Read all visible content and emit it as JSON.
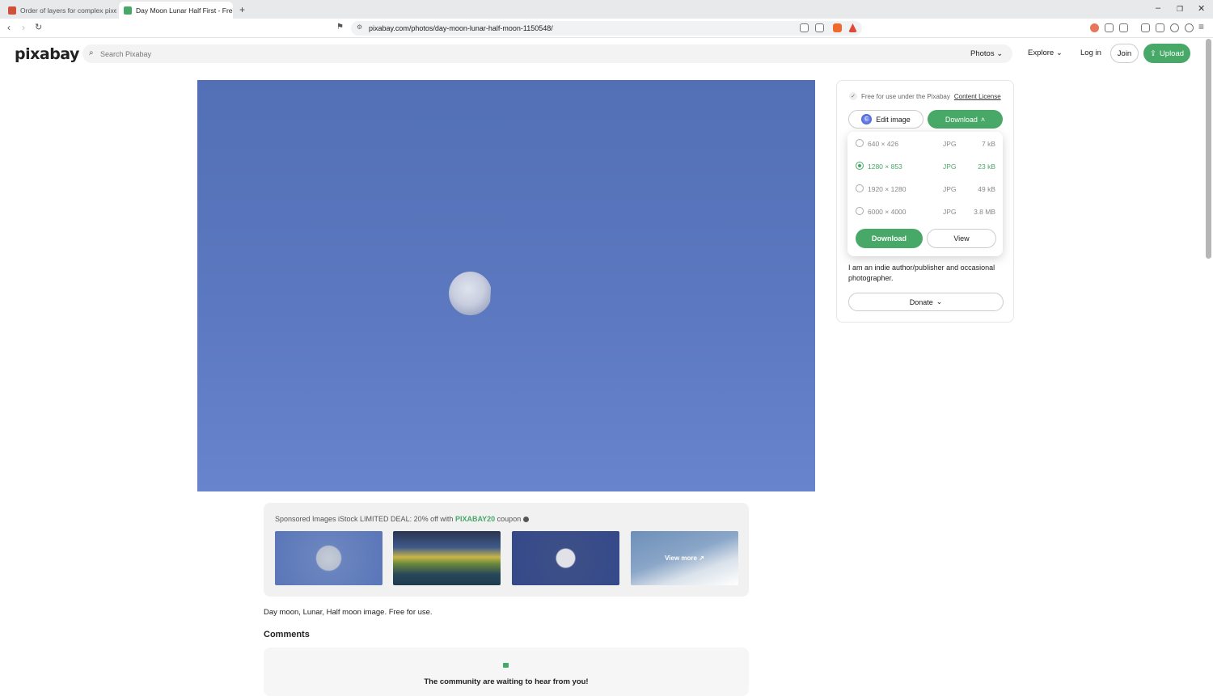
{
  "browser": {
    "tabs": [
      {
        "title": "Order of layers for complex pixel edi",
        "active": false
      },
      {
        "title": "Day Moon Lunar Half First - Free",
        "active": true
      }
    ],
    "new_tab": "+",
    "url": "pixabay.com/photos/day-moon-lunar-half-moon-1150548/",
    "controls": {
      "minimize": "–",
      "restore": "❐",
      "close": "✕"
    }
  },
  "header": {
    "logo": "pixabay",
    "search_placeholder": "Search Pixabay",
    "media_type": "Photos",
    "explore": "Explore",
    "login": "Log in",
    "join": "Join",
    "upload": "Upload"
  },
  "side": {
    "license_text": "Free for use under the Pixabay",
    "license_link": "Content License",
    "edit_image": "Edit image",
    "download": "Download",
    "bio": "I am an indie author/publisher and occasional photographer.",
    "donate": "Donate"
  },
  "download_menu": {
    "options": [
      {
        "dims": "640 × 426",
        "format": "JPG",
        "size": "7 kB",
        "selected": false
      },
      {
        "dims": "1280 × 853",
        "format": "JPG",
        "size": "23 kB",
        "selected": true
      },
      {
        "dims": "1920 × 1280",
        "format": "JPG",
        "size": "49 kB",
        "selected": false
      },
      {
        "dims": "6000 × 4000",
        "format": "JPG",
        "size": "3.8 MB",
        "selected": false
      }
    ],
    "download": "Download",
    "view": "View"
  },
  "sponsored": {
    "prefix": "Sponsored Images iStock LIMITED DEAL: 20% off with",
    "code": "PIXABAY20",
    "suffix": "coupon",
    "view_more": "View more"
  },
  "description": "Day moon, Lunar, Half moon image. Free for use.",
  "comments": {
    "title": "Comments",
    "empty_message": "The community are waiting to hear from you!"
  },
  "colors": {
    "brand_green": "#48a868",
    "sky_blue": "#5b78c0"
  }
}
